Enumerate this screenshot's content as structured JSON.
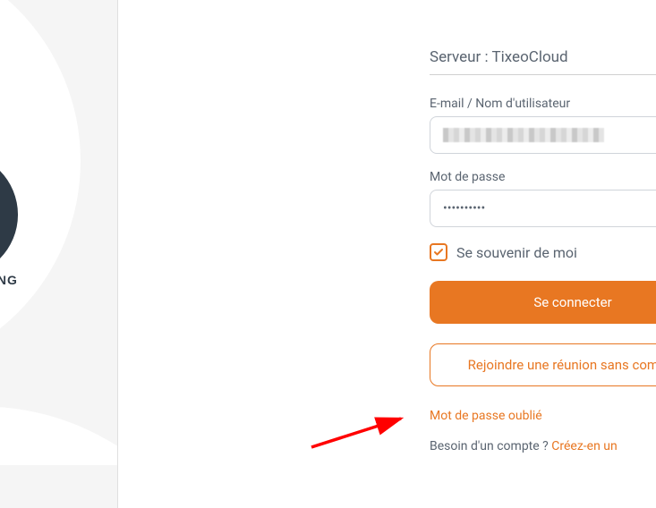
{
  "server": {
    "label_prefix": "Serveur : ",
    "name": "TixeoCloud"
  },
  "fields": {
    "email_label": "E-mail / Nom d'utilisateur",
    "password_label": "Mot de passe",
    "password_value": "••••••••••"
  },
  "remember": {
    "label": "Se souvenir de moi",
    "checked": true
  },
  "buttons": {
    "connect": "Se connecter",
    "join_without_account": "Rejoindre une réunion sans compte"
  },
  "links": {
    "forgot_password": "Mot de passe oublié",
    "need_account_q": "Besoin d'un compte ? ",
    "create_one": "Créez-en un"
  },
  "brand_fragment": "ING",
  "colors": {
    "accent": "#e87722"
  }
}
